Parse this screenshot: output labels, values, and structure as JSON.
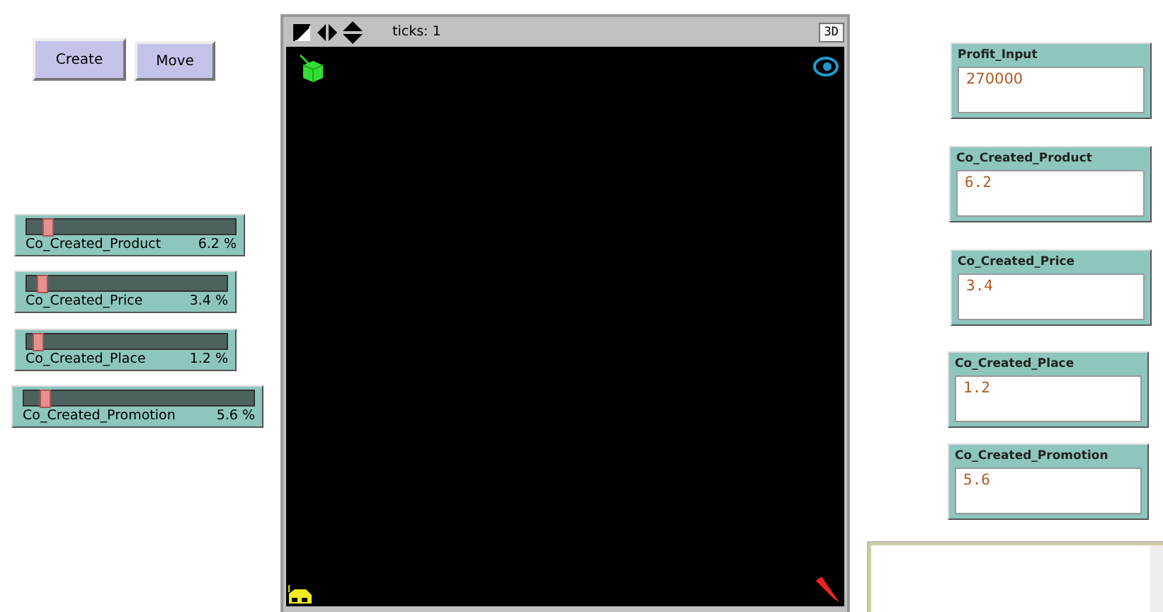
{
  "buttons": [
    {
      "label": "Create"
    },
    {
      "label": "Move"
    }
  ],
  "sliders": [
    {
      "label": "Co_Created_Product",
      "reading": "6.2 %",
      "level": 0.062
    },
    {
      "label": "Co_Created_Price",
      "reading": "3.4 %",
      "level": 0.034
    },
    {
      "label": "Co_Created_Place",
      "reading": "1.2 %",
      "level": 0.012
    },
    {
      "label": "Co_Created_Promotion",
      "reading": "5.6 %",
      "level": 0.056
    }
  ],
  "view": {
    "ticks_label": "ticks: 1",
    "button_3d": "3D"
  },
  "inputs": [
    {
      "label": "Profit_Input",
      "value": "270000",
      "kind": "number"
    },
    {
      "label": "Co_Created_Product",
      "value": "6.2",
      "kind": "mono"
    },
    {
      "label": "Co_Created_Price",
      "value": "3.4",
      "kind": "mono"
    },
    {
      "label": "Co_Created_Place",
      "value": "1.2",
      "kind": "mono"
    },
    {
      "label": "Co_Created_Promotion",
      "value": "5.6",
      "kind": "mono"
    }
  ]
}
